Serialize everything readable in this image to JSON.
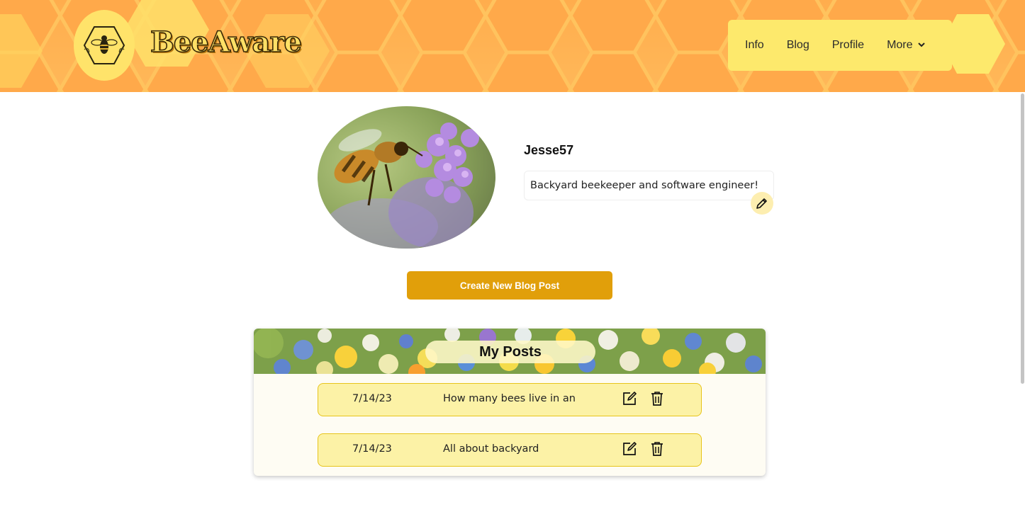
{
  "brand": {
    "name": "BeeAware",
    "logo_icon": "bee-hexagon-logo"
  },
  "nav": {
    "items": [
      {
        "label": "Info"
      },
      {
        "label": "Blog"
      },
      {
        "label": "Profile"
      },
      {
        "label": "More"
      }
    ]
  },
  "profile": {
    "username": "Jesse57",
    "bio": "Backyard beekeeper and software engineer!"
  },
  "actions": {
    "create_post_label": "Create New Blog Post"
  },
  "posts": {
    "title": "My Posts",
    "items": [
      {
        "date": "7/14/23",
        "title": "How many bees live in an"
      },
      {
        "date": "7/14/23",
        "title": "All about backyard"
      }
    ]
  },
  "colors": {
    "header": "#ffad4d",
    "nav_bg": "#fde96c",
    "button": "#e19f0a",
    "post_row": "#fcf2a6"
  }
}
